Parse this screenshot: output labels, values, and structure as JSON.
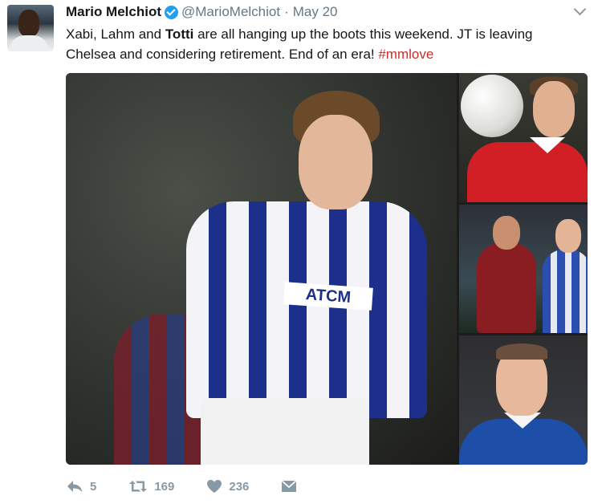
{
  "tweet": {
    "author": {
      "name": "Mario Melchiot",
      "handle": "@MarioMelchiot",
      "verified": true,
      "avatar_icon": "avatar-photo"
    },
    "separator": "·",
    "date": "May 20",
    "text": {
      "part1": "Xabi, Lahm and ",
      "bold": "Totti",
      "part2": " are all hanging up the boots this weekend. JT is leaving Chelsea and considering retirement. End of an era! ",
      "hashtag": "#mmlove"
    },
    "media": {
      "main_sponsor": "ATCM",
      "photos": [
        "main-photo",
        "side-photo-1",
        "side-photo-2",
        "side-photo-3"
      ]
    },
    "actions": {
      "reply": {
        "icon": "reply-icon",
        "count": "5"
      },
      "retweet": {
        "icon": "retweet-icon",
        "count": "169"
      },
      "like": {
        "icon": "heart-icon",
        "count": "236"
      },
      "message": {
        "icon": "direct-message-icon"
      }
    },
    "colors": {
      "text": "#14171a",
      "secondary": "#657786",
      "hashtag": "#c4302b",
      "verified": "#1da1f2",
      "action": "#8899a6"
    }
  }
}
